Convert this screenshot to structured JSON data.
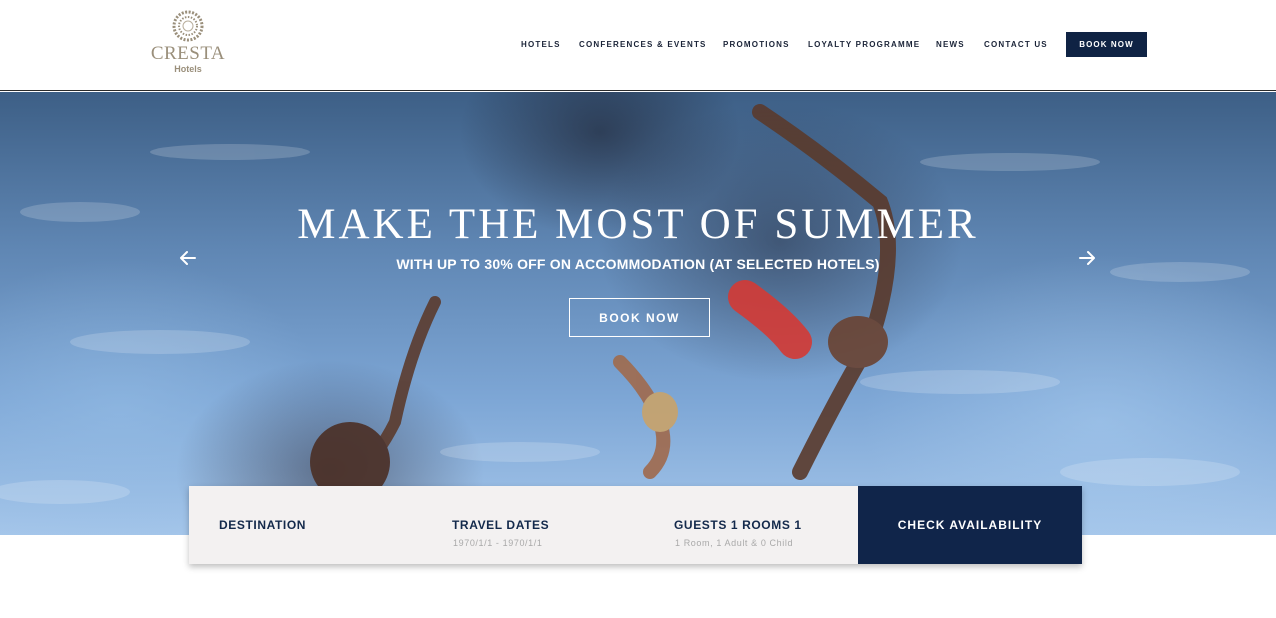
{
  "logo": {
    "name": "CRESTA",
    "sub": "Hotels"
  },
  "nav": {
    "items": [
      {
        "label": "HOTELS"
      },
      {
        "label": "CONFERENCES & EVENTS"
      },
      {
        "label": "PROMOTIONS"
      },
      {
        "label": "LOYALTY PROGRAMME"
      },
      {
        "label": "NEWS"
      },
      {
        "label": "CONTACT US"
      }
    ],
    "book_label": "BOOK NOW"
  },
  "hero": {
    "title": "MAKE THE MOST OF SUMMER",
    "subtitle": "WITH UP TO 30% OFF ON ACCOMMODATION (AT SELECTED HOTELS)",
    "button_label": "BOOK NOW",
    "prev_icon": "arrow-left-icon",
    "next_icon": "arrow-right-icon"
  },
  "booking": {
    "destination_label": "DESTINATION",
    "dates_label": "TRAVEL DATES",
    "dates_value": "1970/1/1 - 1970/1/1",
    "guests_label": "GUESTS 1 ROOMS 1",
    "guests_value": "1 Room, 1 Adult & 0 Child",
    "check_label": "CHECK AVAILABILITY"
  },
  "colors": {
    "brand_navy": "#10254a",
    "logo_gold": "#9a8f7b",
    "panel_bg": "#f3f1f1"
  }
}
